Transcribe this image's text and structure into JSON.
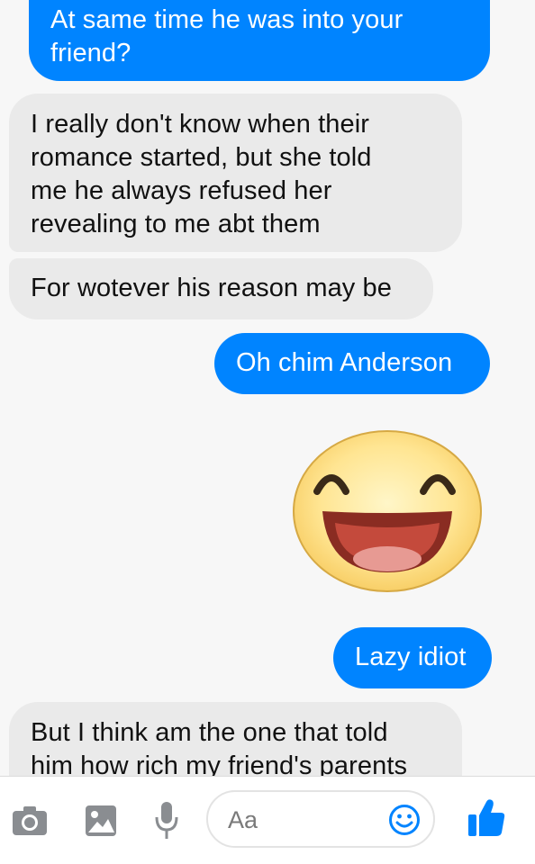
{
  "conversation": {
    "messages": [
      {
        "sender": "me",
        "text": "At same time he was into your\nfriend?"
      },
      {
        "sender": "them",
        "text": "I really don't know when their\nromance started, but she told\nme he always refused her\nrevealing to me abt them"
      },
      {
        "sender": "them",
        "text": "For wotever his reason may be"
      },
      {
        "sender": "me",
        "text": "Oh chim Anderson"
      },
      {
        "sender": "me",
        "emoji": "laughing-face-sticker"
      },
      {
        "sender": "me",
        "text": "Lazy idiot"
      },
      {
        "sender": "them",
        "text": "But I think am the one that told\nhim how rich my friend's parents"
      }
    ]
  },
  "composer": {
    "placeholder": "Aa",
    "icons": [
      "camera-icon",
      "image-icon",
      "microphone-icon",
      "emoji-icon",
      "thumbs-up-icon"
    ]
  },
  "colors": {
    "outgoing_bubble": "#0084ff",
    "incoming_bubble": "#eaeaea",
    "accent": "#0084ff"
  }
}
